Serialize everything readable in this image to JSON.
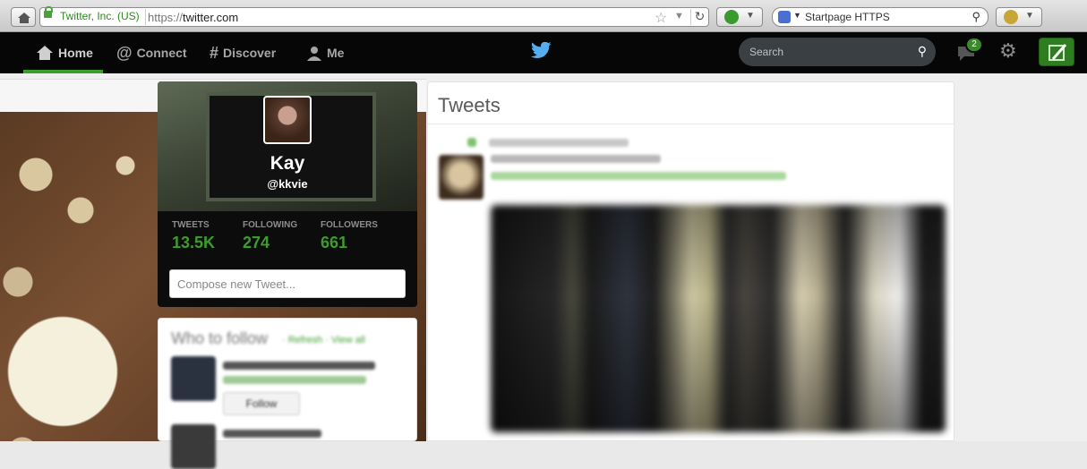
{
  "browser": {
    "ssl_label": "Twitter, Inc. (US)",
    "url_protocol": "https://",
    "url_host": "twitter.com",
    "search_engine": "Startpage HTTPS",
    "icons": [
      "home-icon",
      "lock-icon",
      "star-icon",
      "reload-icon",
      "magnifier-icon"
    ]
  },
  "nav": {
    "home": "Home",
    "connect": "Connect",
    "discover": "Discover",
    "me": "Me",
    "search_placeholder": "Search",
    "dm_count": "2",
    "accent": "#3d9d2c"
  },
  "profile": {
    "name": "Kay",
    "handle": "@kkvie",
    "tweets_label": "TWEETS",
    "tweets_value": "13.5K",
    "following_label": "FOLLOWING",
    "following_value": "274",
    "followers_label": "FOLLOWERS",
    "followers_value": "661",
    "compose_placeholder": "Compose new Tweet..."
  },
  "who_to_follow": {
    "title": "Who to follow",
    "links": "· Refresh · View all",
    "follow_label": "Follow"
  },
  "tweets": {
    "title": "Tweets"
  }
}
